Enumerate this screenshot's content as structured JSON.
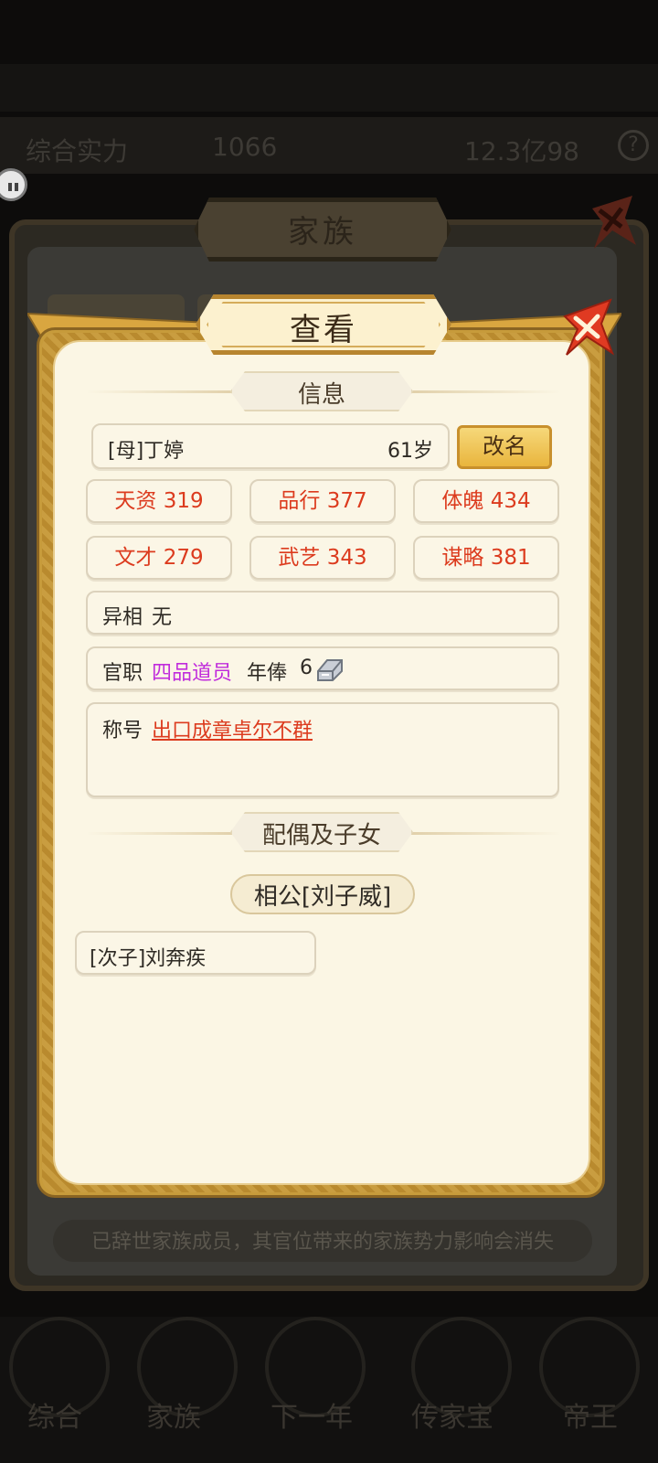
{
  "background": {
    "resource_left": "综合实力",
    "resource_mid": "1066",
    "resource_right": "12.3亿98",
    "nav": [
      "综合",
      "家族",
      "下一年",
      "传家宝",
      "帝王"
    ]
  },
  "family_window": {
    "title": "家族",
    "hint": "已辞世家族成员，其官位带来的家族势力影响会消失"
  },
  "dialog": {
    "title": "查看",
    "info_section": "信息",
    "member": {
      "name": "[母]丁婷",
      "age": "61岁"
    },
    "rename_label": "改名",
    "stats": [
      {
        "label": "天资",
        "value": "319"
      },
      {
        "label": "品行",
        "value": "377"
      },
      {
        "label": "体魄",
        "value": "434"
      },
      {
        "label": "文才",
        "value": "279"
      },
      {
        "label": "武艺",
        "value": "343"
      },
      {
        "label": "谋略",
        "value": "381"
      }
    ],
    "trait": {
      "label": "异相",
      "value": "无"
    },
    "office": {
      "label": "官职",
      "rank": "四品道员",
      "salary_label": "年俸",
      "salary_value": "6"
    },
    "title_field": {
      "label": "称号",
      "value": "出口成章卓尔不群"
    },
    "family_section": "配偶及子女",
    "spouse": "相公[刘子威]",
    "children": [
      "[次子]刘奔疾"
    ]
  },
  "colors": {
    "stat_red": "#dc3b1e",
    "rank_purple": "#c02cdc",
    "frame_gold": "#c79b3b",
    "paper": "#fbf6e4"
  },
  "icons": [
    "chat-icon",
    "help-icon",
    "close-icon",
    "silver-ingot-icon"
  ]
}
